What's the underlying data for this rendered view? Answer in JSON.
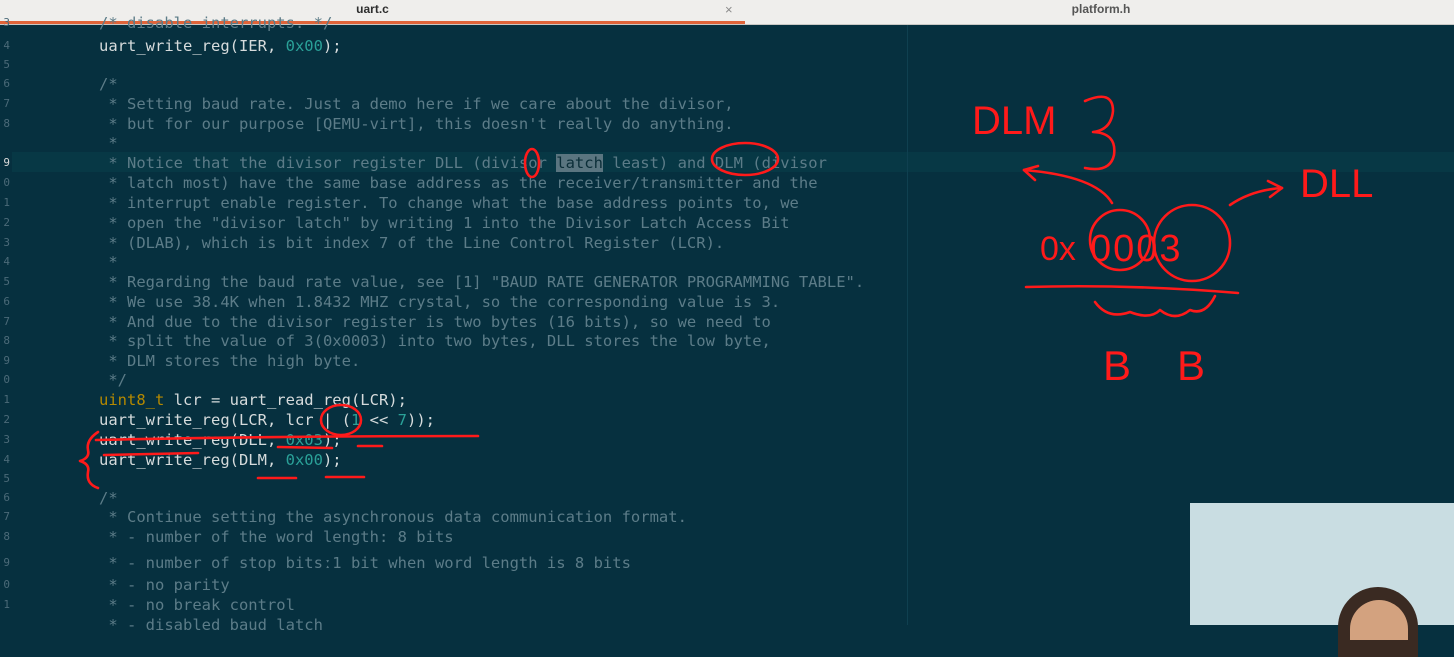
{
  "tabs": {
    "active": "uart.c",
    "inactive": "platform.h",
    "close_glyph": "×"
  },
  "gutter": [
    "3",
    "4",
    "5",
    "6",
    "7",
    "8",
    "9",
    "0",
    "1",
    "2",
    "3",
    "4",
    "5",
    "6",
    "7",
    "8",
    "9",
    "0",
    "1",
    "2",
    "3",
    "4",
    "5",
    "6",
    "7",
    "8",
    "9",
    "0",
    "1"
  ],
  "current_line_index": 6,
  "code": {
    "l0": "/* disable interrupts. */",
    "l1_fn": "uart_write_reg(IER, ",
    "l1_hex": "0x00",
    "l1_end": ");",
    "l3": "/*",
    "l4": " * Setting baud rate. Just a demo here if we care about the divisor,",
    "l5": " * but for our purpose [QEMU-virt], this doesn't really do anything.",
    "l6": " *",
    "l7_a": " * Notice that the divisor register DLL (divisor ",
    "l7_sel": "latch",
    "l7_b": " least) and DLM (divisor",
    "l8": " * latch most) have the same base address as the receiver/transmitter and the",
    "l9": " * interrupt enable register. To change what the base address points to, we",
    "l10": " * open the \"divisor latch\" by writing 1 into the Divisor Latch Access Bit",
    "l11": " * (DLAB), which is bit index 7 of the Line Control Register (LCR).",
    "l12": " *",
    "l13": " * Regarding the baud rate value, see [1] \"BAUD RATE GENERATOR PROGRAMMING TABLE\".",
    "l14": " * We use 38.4K when 1.8432 MHZ crystal, so the corresponding value is 3.",
    "l15": " * And due to the divisor register is two bytes (16 bits), so we need to",
    "l16": " * split the value of 3(0x0003) into two bytes, DLL stores the low byte,",
    "l17": " * DLM stores the high byte.",
    "l18": " */",
    "l19_type": "uint8_t",
    "l19_rest": " lcr = uart_read_reg(LCR);",
    "l20_a": "uart_write_reg(LCR, lcr | (",
    "l20_num": "1",
    "l20_b": " << ",
    "l20_num2": "7",
    "l20_c": "));",
    "l21_a": "uart_write_reg(DLL, ",
    "l21_hex": "0x03",
    "l21_b": ");",
    "l22_a": "uart_write_reg(DLM, ",
    "l22_hex": "0x00",
    "l22_b": ");",
    "l24": "/*",
    "l25": " * Continue setting the asynchronous data communication format.",
    "l26": " * - number of the word length: 8 bits",
    "l27": " * - number of stop bitsː1 bit when word length is 8 bits",
    "l28": " * - no parity",
    "l29": " * - no break control",
    "l30": " * - disabled baud latch"
  },
  "annotations": {
    "dlm": "DLM",
    "three": "3",
    "dll": "DLL",
    "hex_prefix": "0x",
    "hex_digits": "0003",
    "byte_a": "B",
    "byte_b": "B"
  },
  "colors": {
    "background": "#06303f",
    "comment": "#5c7c88",
    "hex": "#2aa198",
    "type": "#b58900",
    "ink": "#ff1a1a",
    "tab_accent": "#e0643a"
  }
}
